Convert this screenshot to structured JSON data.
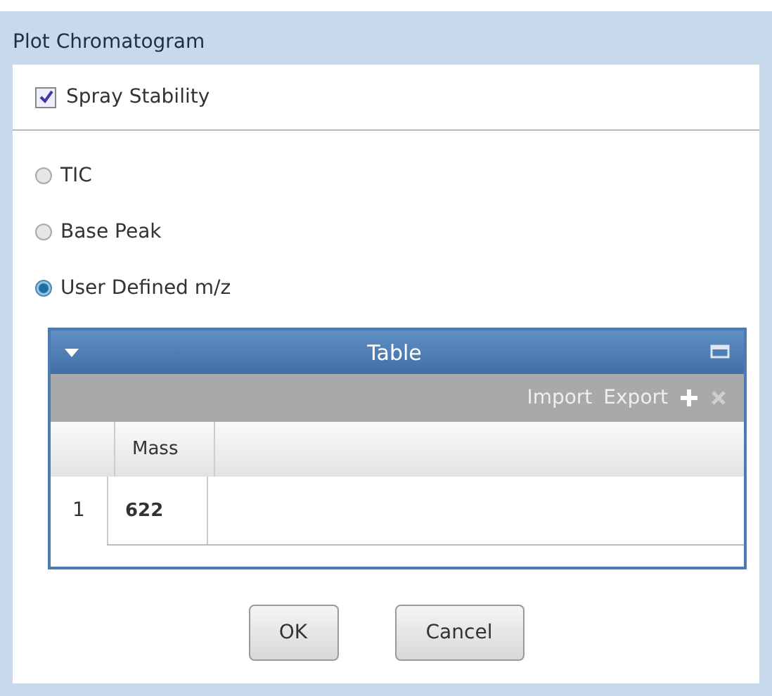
{
  "window": {
    "title": "Plot Chromatogram"
  },
  "spray_stability": {
    "label": "Spray Stability",
    "checked": true
  },
  "radios": [
    {
      "label": "TIC",
      "selected": false
    },
    {
      "label": "Base Peak",
      "selected": false
    },
    {
      "label": "User Defined m/z",
      "selected": true
    }
  ],
  "table_panel": {
    "title": "Table",
    "toolbar": [
      "Import",
      "Export"
    ],
    "columns": [
      "Mass"
    ],
    "rows": [
      {
        "index": "1",
        "mass": "622"
      }
    ]
  },
  "buttons": [
    "OK",
    "Cancel"
  ]
}
